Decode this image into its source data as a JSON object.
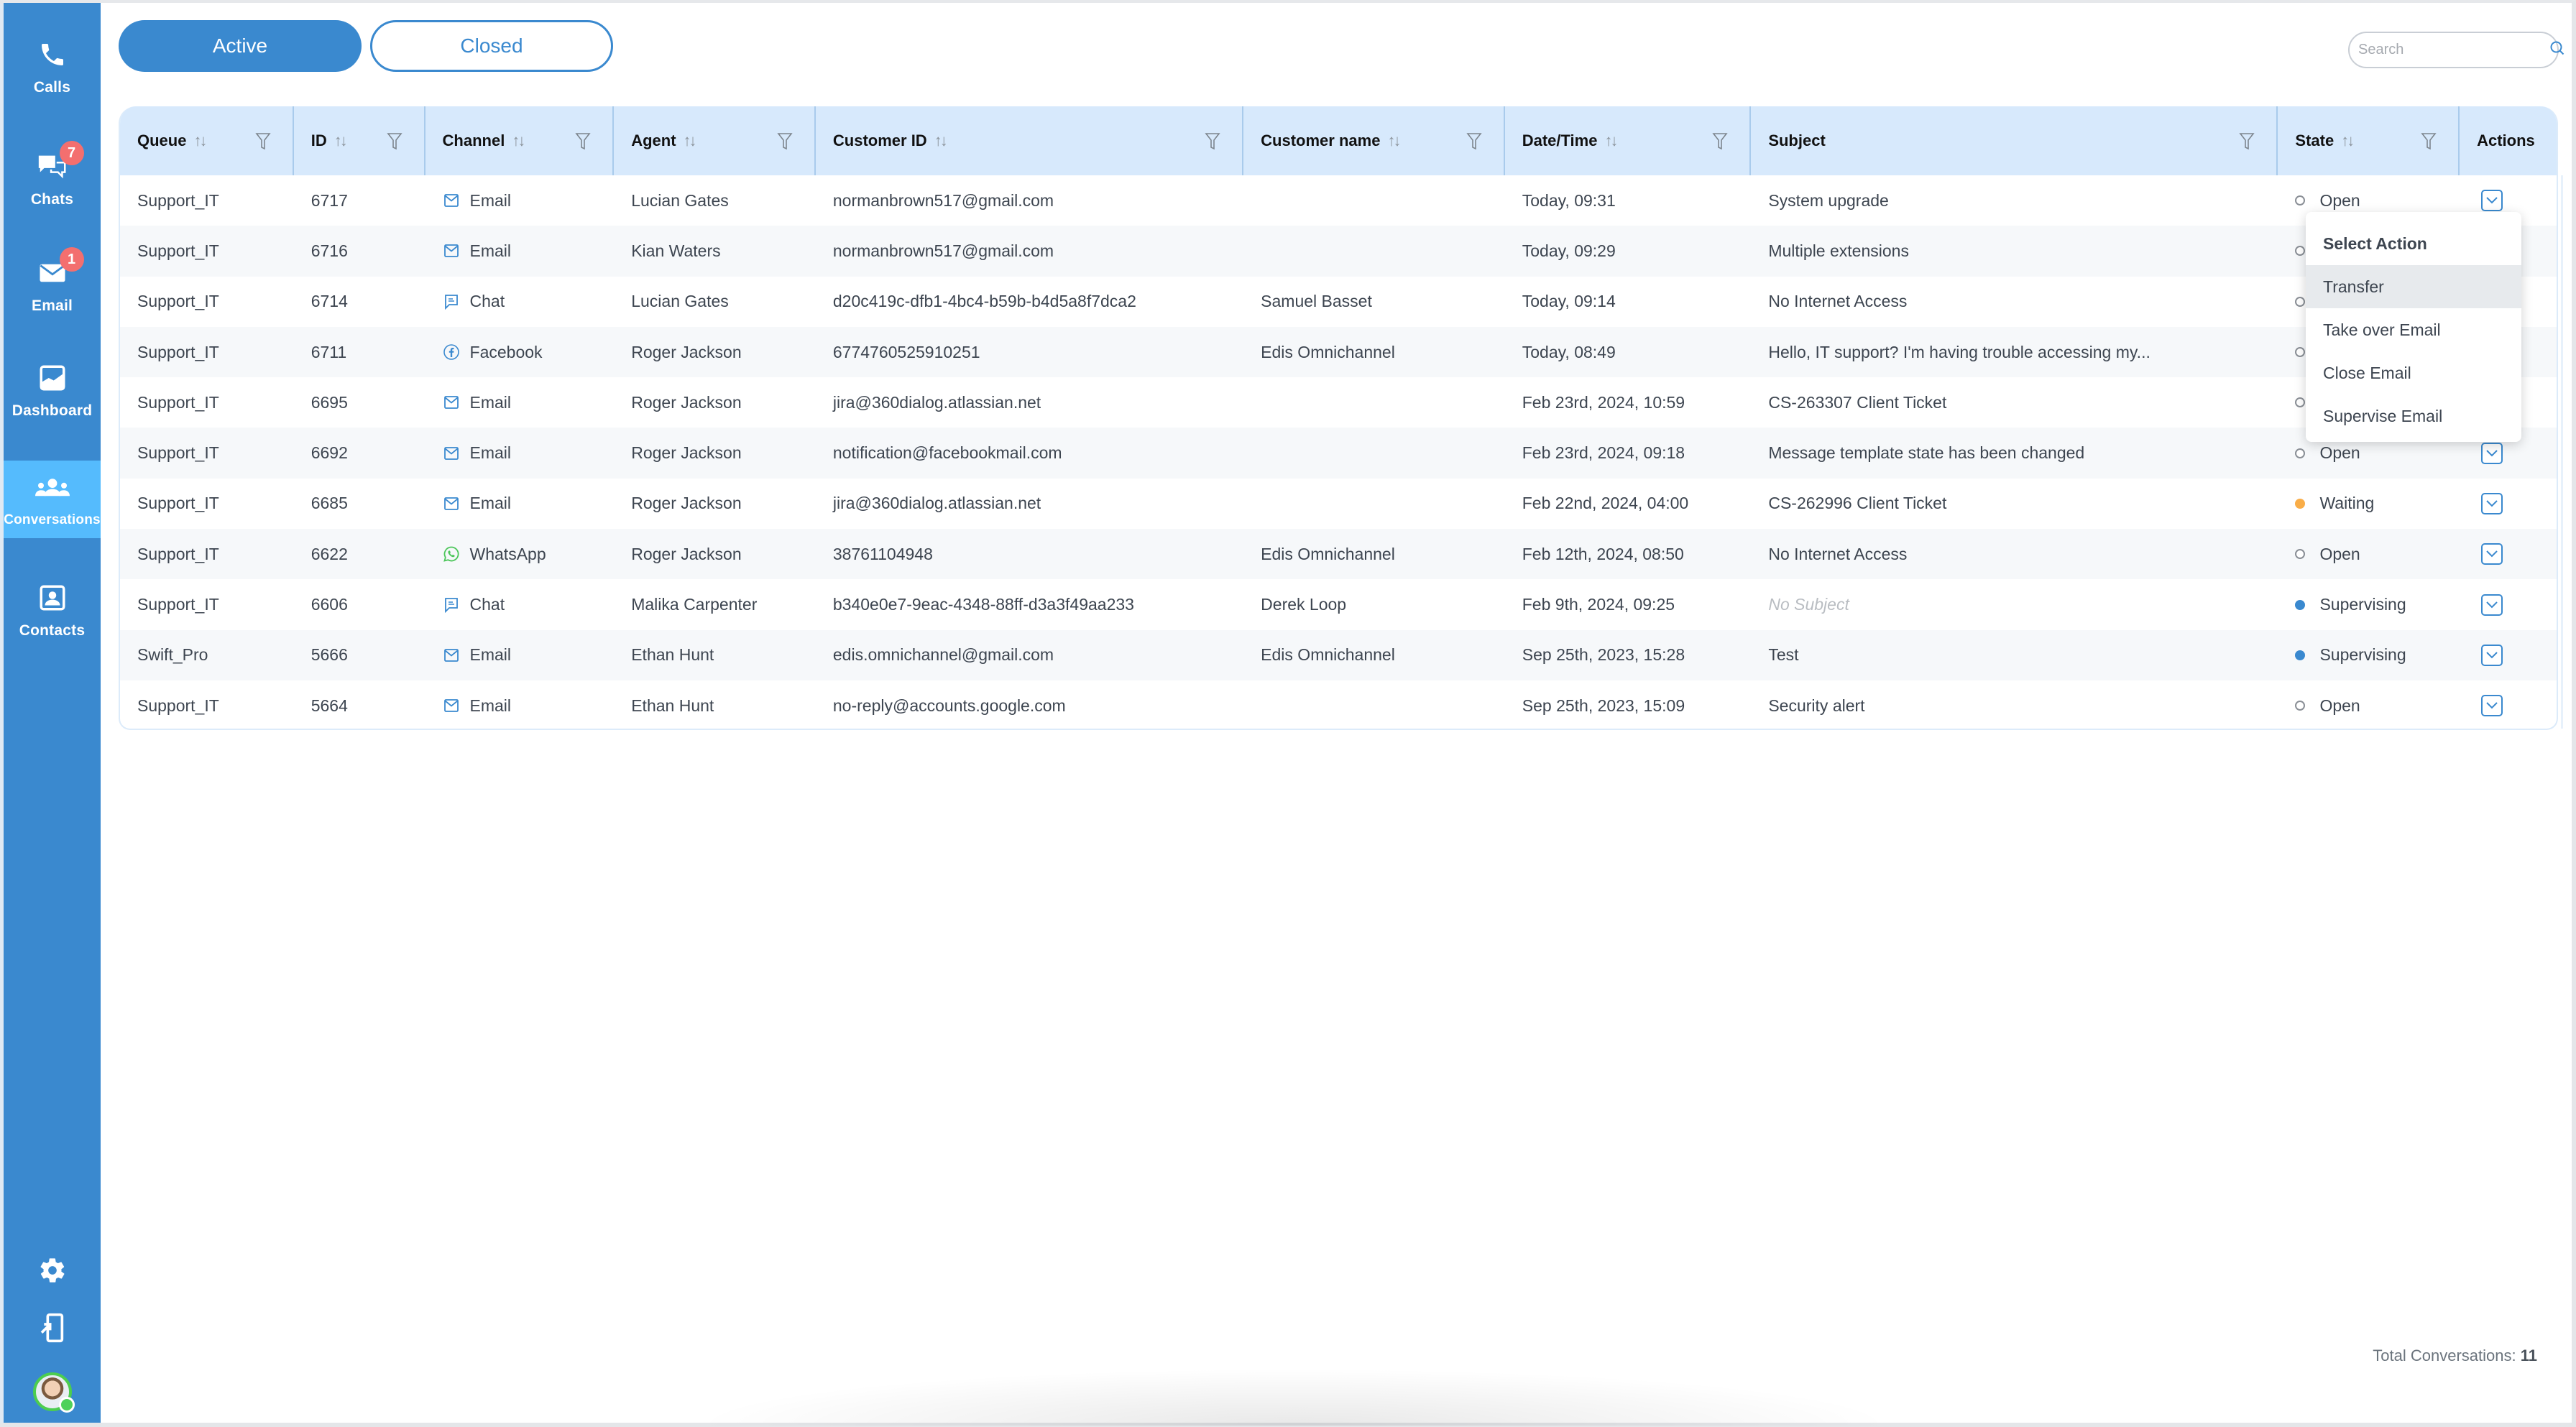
{
  "sidebar": {
    "items": [
      {
        "label": "Calls",
        "icon": "phone-icon",
        "badge": null
      },
      {
        "label": "Chats",
        "icon": "chat-bubbles-icon",
        "badge": "7"
      },
      {
        "label": "Email",
        "icon": "envelope-icon",
        "badge": "1"
      },
      {
        "label": "Dashboard",
        "icon": "chart-icon",
        "badge": null
      },
      {
        "label": "Conversations",
        "icon": "people-icon",
        "badge": null,
        "active": true
      },
      {
        "label": "Contacts",
        "icon": "contact-card-icon",
        "badge": null
      }
    ],
    "bottom": [
      {
        "icon": "gear-icon"
      },
      {
        "icon": "logout-device-icon"
      },
      {
        "icon": "user-avatar",
        "status": "online"
      }
    ]
  },
  "tabs": {
    "active_label": "Active",
    "closed_label": "Closed"
  },
  "search": {
    "placeholder": "Search",
    "value": ""
  },
  "table": {
    "columns": [
      {
        "label": "Queue",
        "sortable": true,
        "filterable": true
      },
      {
        "label": "ID",
        "sortable": true,
        "filterable": true
      },
      {
        "label": "Channel",
        "sortable": true,
        "filterable": true
      },
      {
        "label": "Agent",
        "sortable": true,
        "filterable": true
      },
      {
        "label": "Customer ID",
        "sortable": true,
        "filterable": true
      },
      {
        "label": "Customer name",
        "sortable": true,
        "filterable": true
      },
      {
        "label": "Date/Time",
        "sortable": true,
        "filterable": true
      },
      {
        "label": "Subject",
        "sortable": false,
        "filterable": true
      },
      {
        "label": "State",
        "sortable": true,
        "filterable": true
      },
      {
        "label": "Actions",
        "sortable": false,
        "filterable": false
      }
    ],
    "sort_glyph": "↑↓",
    "rows": [
      {
        "queue": "Support_IT",
        "id": "6717",
        "channel": "Email",
        "channel_icon": "email",
        "agent": "Lucian Gates",
        "customer_id": "normanbrown517@gmail.com",
        "customer_name": "",
        "datetime": "Today, 09:31",
        "subject": "System upgrade",
        "state": "Open"
      },
      {
        "queue": "Support_IT",
        "id": "6716",
        "channel": "Email",
        "channel_icon": "email",
        "agent": "Kian Waters",
        "customer_id": "normanbrown517@gmail.com",
        "customer_name": "",
        "datetime": "Today, 09:29",
        "subject": "Multiple extensions",
        "state": "Open"
      },
      {
        "queue": "Support_IT",
        "id": "6714",
        "channel": "Chat",
        "channel_icon": "chat",
        "agent": "Lucian Gates",
        "customer_id": "d20c419c-dfb1-4bc4-b59b-b4d5a8f7dca2",
        "customer_name": "Samuel Basset",
        "datetime": "Today, 09:14",
        "subject": "No Internet Access",
        "state": "Open"
      },
      {
        "queue": "Support_IT",
        "id": "6711",
        "channel": "Facebook",
        "channel_icon": "facebook",
        "agent": "Roger Jackson",
        "customer_id": "6774760525910251",
        "customer_name": "Edis Omnichannel",
        "datetime": "Today, 08:49",
        "subject": "Hello, IT support? I'm having trouble accessing my...",
        "state": "Open"
      },
      {
        "queue": "Support_IT",
        "id": "6695",
        "channel": "Email",
        "channel_icon": "email",
        "agent": "Roger Jackson",
        "customer_id": "jira@360dialog.atlassian.net",
        "customer_name": "",
        "datetime": "Feb 23rd, 2024, 10:59",
        "subject": "CS-263307 Client Ticket",
        "state": "Open"
      },
      {
        "queue": "Support_IT",
        "id": "6692",
        "channel": "Email",
        "channel_icon": "email",
        "agent": "Roger Jackson",
        "customer_id": "notification@facebookmail.com",
        "customer_name": "",
        "datetime": "Feb 23rd, 2024, 09:18",
        "subject": "Message template state has been changed",
        "state": "Open"
      },
      {
        "queue": "Support_IT",
        "id": "6685",
        "channel": "Email",
        "channel_icon": "email",
        "agent": "Roger Jackson",
        "customer_id": "jira@360dialog.atlassian.net",
        "customer_name": "",
        "datetime": "Feb 22nd, 2024, 04:00",
        "subject": "CS-262996 Client Ticket",
        "state": "Waiting"
      },
      {
        "queue": "Support_IT",
        "id": "6622",
        "channel": "WhatsApp",
        "channel_icon": "whatsapp",
        "agent": "Roger Jackson",
        "customer_id": "38761104948",
        "customer_name": "Edis Omnichannel",
        "datetime": "Feb 12th, 2024, 08:50",
        "subject": "No Internet Access",
        "state": "Open"
      },
      {
        "queue": "Support_IT",
        "id": "6606",
        "channel": "Chat",
        "channel_icon": "chat",
        "agent": "Malika Carpenter",
        "customer_id": "b340e0e7-9eac-4348-88ff-d3a3f49aa233",
        "customer_name": "Derek Loop",
        "datetime": "Feb 9th, 2024, 09:25",
        "subject": "No Subject",
        "subject_placeholder": true,
        "state": "Supervising"
      },
      {
        "queue": "Swift_Pro",
        "id": "5666",
        "channel": "Email",
        "channel_icon": "email",
        "agent": "Ethan Hunt",
        "customer_id": "edis.omnichannel@gmail.com",
        "customer_name": "Edis Omnichannel",
        "datetime": "Sep 25th, 2023, 15:28",
        "subject": "Test",
        "state": "Supervising"
      },
      {
        "queue": "Support_IT",
        "id": "5664",
        "channel": "Email",
        "channel_icon": "email",
        "agent": "Ethan Hunt",
        "customer_id": "no-reply@accounts.google.com",
        "customer_name": "",
        "datetime": "Sep 25th, 2023, 15:09",
        "subject": "Security alert",
        "state": "Open"
      }
    ]
  },
  "action_menu": {
    "title": "Select Action",
    "items": [
      "Transfer",
      "Take over Email",
      "Close Email",
      "Supervise Email"
    ],
    "highlighted": "Transfer"
  },
  "footer": {
    "total_label": "Total Conversations:",
    "total_value": "11"
  },
  "colors": {
    "primary": "#3a89cf",
    "sidebar_active": "#55bbfd",
    "header_bg": "#d7e9fc",
    "badge": "#f36f6f",
    "state_waiting": "#f9ad48",
    "state_supervising": "#3a89cf",
    "whatsapp": "#4cc65a"
  }
}
